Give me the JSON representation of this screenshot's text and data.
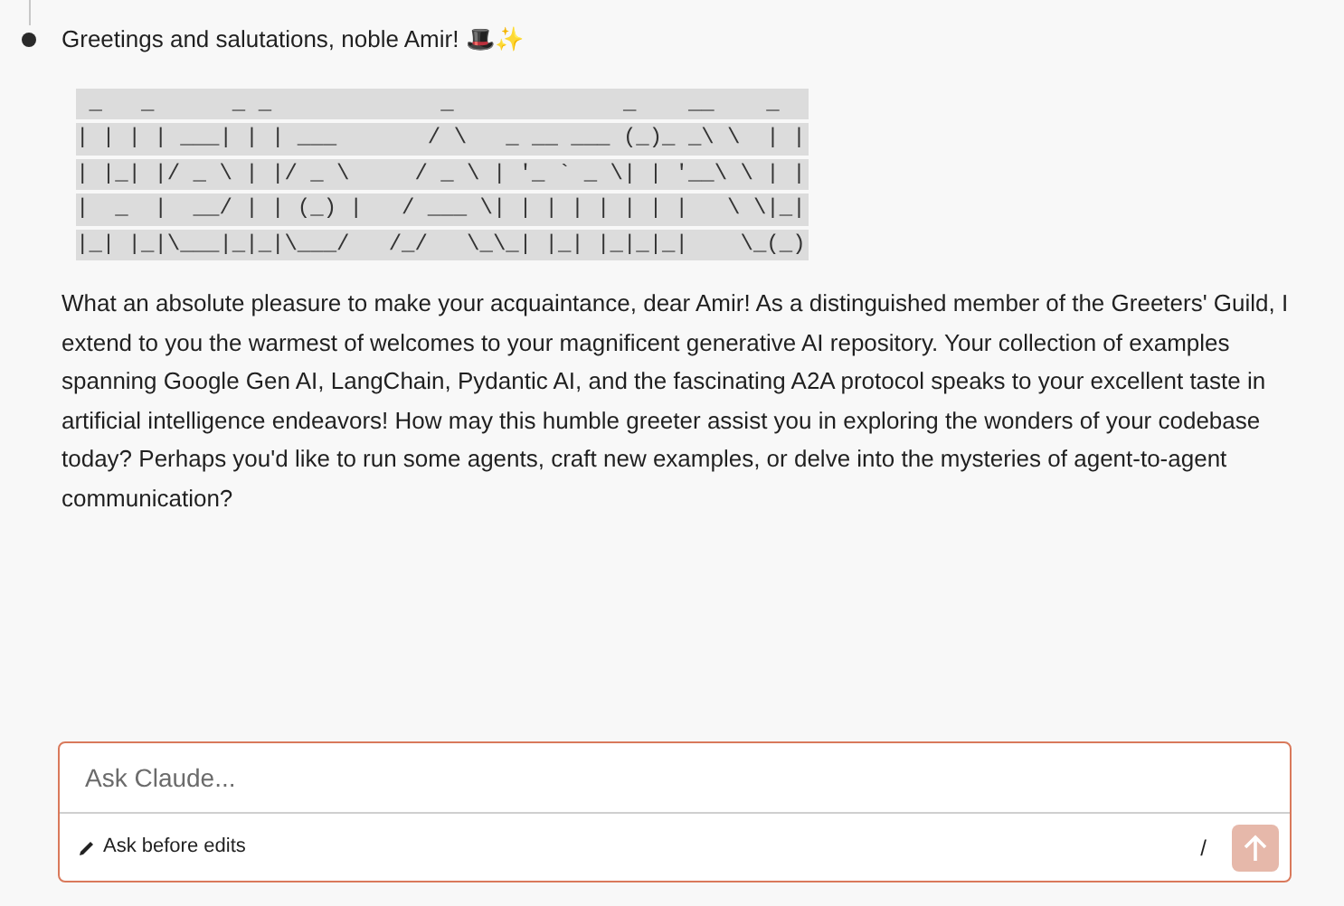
{
  "message": {
    "greeting": "Greetings and salutations, noble Amir! 🎩✨",
    "ascii_art": [
      " _   _      _ _             _             _    __    _",
      "| | | | ___| | | ___       / \\   _ __ ___ (_)_ _\\ \\  | |",
      "| |_| |/ _ \\ | |/ _ \\     / _ \\ | '_ ` _ \\| | '__\\ \\ | |",
      "|  _  |  __/ | | (_) |   / ___ \\| | | | | | | |   \\ \\|_|",
      "|_| |_|\\___|_|_|\\___/   /_/   \\_\\_| |_| |_|_|_|    \\_(_)"
    ],
    "body": "What an absolute pleasure to make your acquaintance, dear Amir! As a distinguished member of the Greeters' Guild, I extend to you the warmest of welcomes to your magnificent generative AI repository. Your collection of examples spanning Google Gen AI, LangChain, Pydantic AI, and the fascinating A2A protocol speaks to your excellent taste in artificial intelligence endeavors! How may this humble greeter assist you in exploring the wonders of your codebase today? Perhaps you'd like to run some agents, craft new examples, or delve into the mysteries of agent-to-agent communication?"
  },
  "composer": {
    "placeholder": "Ask Claude...",
    "mode": "Ask before edits",
    "shortcut": "/",
    "send_disabled": true
  }
}
